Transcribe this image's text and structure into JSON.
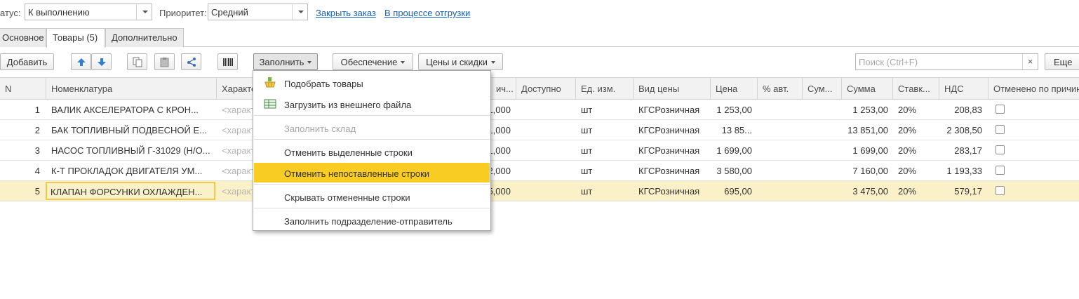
{
  "status": {
    "label": "атус:",
    "value": "К выполнению",
    "priority_label": "Приоритет:",
    "priority_value": "Средний",
    "link_close": "Закрыть заказ",
    "link_shipping": "В процессе отгрузки"
  },
  "tabs": [
    {
      "label": "Основное"
    },
    {
      "label": "Товары (5)"
    },
    {
      "label": "Дополнительно"
    }
  ],
  "toolbar": {
    "add": "Добавить",
    "fill": "Заполнить",
    "supply": "Обеспечение",
    "prices": "Цены и скидки",
    "search_placeholder": "Поиск (Ctrl+F)",
    "clear": "×",
    "more": "Еще"
  },
  "columns": [
    "N",
    "Номенклатура",
    "Характе",
    "ич...",
    "Доступно",
    "Ед. изм.",
    "Вид цены",
    "Цена",
    "% авт.",
    "Сум...",
    "Сумма",
    "Ставк...",
    "НДС",
    "Отменено по причине"
  ],
  "rows": [
    {
      "n": "1",
      "name": "ВАЛИК АКСЕЛЕРАТОРА С КРОН...",
      "char": "<характ",
      "qty": "1,000",
      "unit": "шт",
      "price_type": "КГСРозничная",
      "price": "1 253,00",
      "sum": "1 253,00",
      "rate": "20%",
      "vat": "208,83"
    },
    {
      "n": "2",
      "name": "БАК ТОПЛИВНЫЙ ПОДВЕСНОЙ Е...",
      "char": "<характ",
      "qty": "1,000",
      "unit": "шт",
      "price_type": "КГСРозничная",
      "price": "13 85...",
      "sum": "13 851,00",
      "rate": "20%",
      "vat": "2 308,50"
    },
    {
      "n": "3",
      "name": "НАСОС ТОПЛИВНЫЙ Г-31029 (Н/О...",
      "char": "<характ",
      "qty": "1,000",
      "unit": "шт",
      "price_type": "КГСРозничная",
      "price": "1 699,00",
      "sum": "1 699,00",
      "rate": "20%",
      "vat": "283,17"
    },
    {
      "n": "4",
      "name": "К-Т ПРОКЛАДОК ДВИГАТЕЛЯ УМ...",
      "char": "<характ",
      "qty": "2,000",
      "unit": "шт",
      "price_type": "КГСРозничная",
      "price": "3 580,00",
      "sum": "7 160,00",
      "rate": "20%",
      "vat": "1 193,33"
    },
    {
      "n": "5",
      "name": "КЛАПАН ФОРСУНКИ ОХЛАЖДЕН...",
      "char": "<характ",
      "qty": "5,000",
      "unit": "шт",
      "price_type": "КГСРозничная",
      "price": "695,00",
      "sum": "3 475,00",
      "rate": "20%",
      "vat": "579,17"
    }
  ],
  "menu": [
    {
      "label": "Подобрать товары",
      "icon": "basket-icon",
      "disabled": false,
      "highlight": false
    },
    {
      "label": "Загрузить из внешнего файла",
      "icon": "import-file-icon",
      "disabled": false,
      "highlight": false
    },
    {
      "label": "Заполнить склад",
      "icon": "",
      "disabled": true,
      "highlight": false
    },
    {
      "label": "Отменить выделенные строки",
      "icon": "",
      "disabled": false,
      "highlight": false
    },
    {
      "label": "Отменить непоставленные строки",
      "icon": "",
      "disabled": false,
      "highlight": true
    },
    {
      "label": "Скрывать отмененные строки",
      "icon": "",
      "disabled": false,
      "highlight": false
    },
    {
      "label": "Заполнить подразделение-отправитель",
      "icon": "",
      "disabled": false,
      "highlight": false
    }
  ],
  "colors": {
    "accent_highlight": "#f8cc23",
    "selected_row": "#fbf1c8",
    "link": "#1a5fb4"
  }
}
